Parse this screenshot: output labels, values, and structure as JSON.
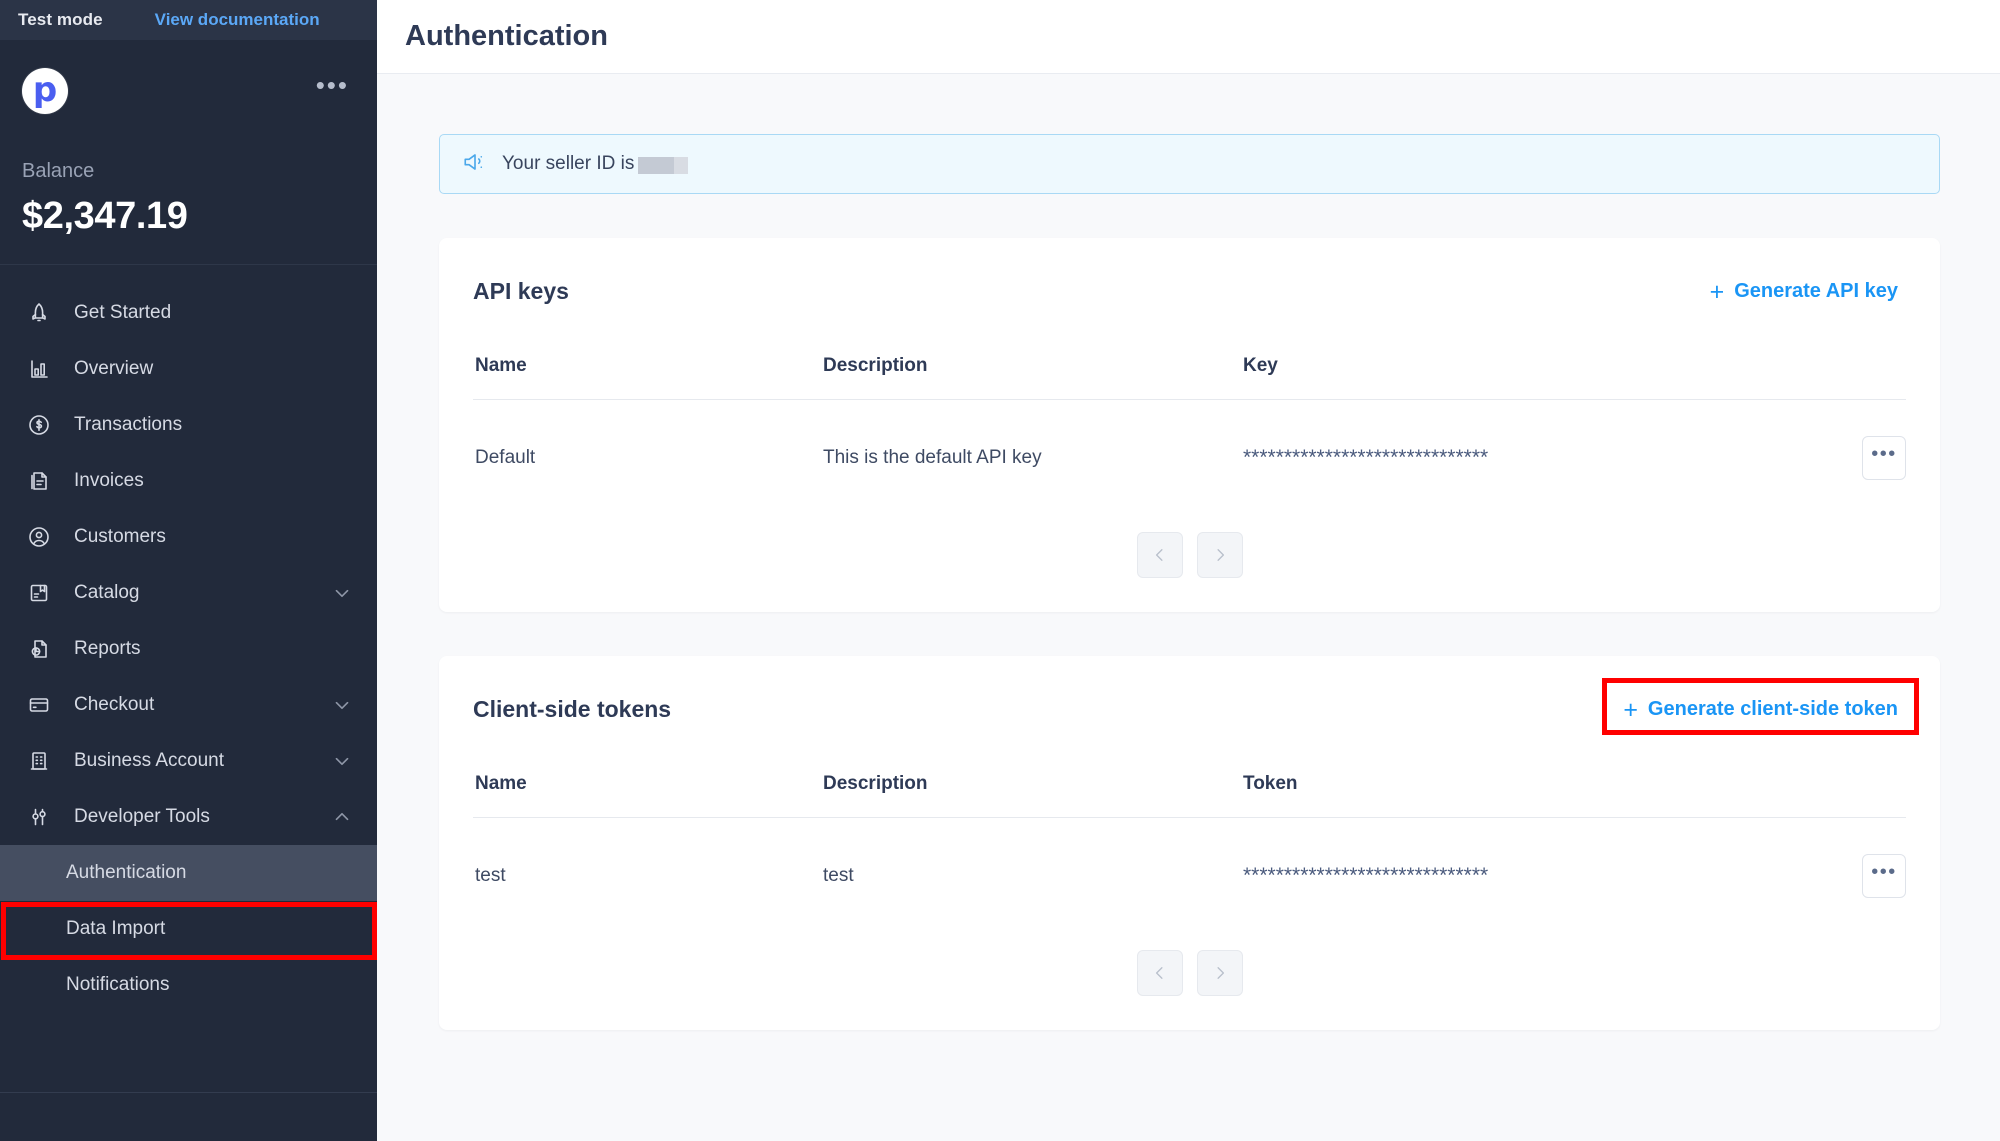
{
  "topbar": {
    "test_mode_label": "Test mode",
    "view_documentation_label": "View documentation"
  },
  "sidebar": {
    "brand_logo_letter": "p",
    "kebab_label": "•••",
    "balance_label": "Balance",
    "balance_value": "$2,347.19",
    "items": [
      {
        "label": "Get Started",
        "icon": "rocket-icon",
        "expandable": false
      },
      {
        "label": "Overview",
        "icon": "bar-chart-icon",
        "expandable": false
      },
      {
        "label": "Transactions",
        "icon": "dollar-circle-icon",
        "expandable": false
      },
      {
        "label": "Invoices",
        "icon": "invoice-icon",
        "expandable": false
      },
      {
        "label": "Customers",
        "icon": "user-circle-icon",
        "expandable": false
      },
      {
        "label": "Catalog",
        "icon": "box-icon",
        "expandable": true,
        "expanded": false
      },
      {
        "label": "Reports",
        "icon": "report-icon",
        "expandable": false
      },
      {
        "label": "Checkout",
        "icon": "card-icon",
        "expandable": true,
        "expanded": false
      },
      {
        "label": "Business Account",
        "icon": "building-icon",
        "expandable": true,
        "expanded": false
      },
      {
        "label": "Developer Tools",
        "icon": "sliders-icon",
        "expandable": true,
        "expanded": true
      }
    ],
    "sub_items": [
      {
        "label": "Authentication",
        "active": true
      },
      {
        "label": "Data Import",
        "active": false
      },
      {
        "label": "Notifications",
        "active": false
      }
    ]
  },
  "page": {
    "title": "Authentication"
  },
  "banner": {
    "icon": "megaphone-icon",
    "text": "Your seller ID is",
    "redacted_value": ""
  },
  "api_keys_card": {
    "title": "API keys",
    "generate_button": {
      "label": "Generate API key",
      "plus": "+"
    },
    "columns": [
      "Name",
      "Description",
      "Key"
    ],
    "rows": [
      {
        "name": "Default",
        "description": "This is the default API key",
        "key": "******************************",
        "actions_label": "•••"
      }
    ],
    "pagination": {
      "prev": "‹",
      "next": "›"
    }
  },
  "client_tokens_card": {
    "title": "Client-side tokens",
    "generate_button": {
      "label": "Generate client-side token",
      "plus": "+"
    },
    "columns": [
      "Name",
      "Description",
      "Token"
    ],
    "rows": [
      {
        "name": "test",
        "description": "test",
        "key": "******************************",
        "actions_label": "•••"
      }
    ],
    "pagination": {
      "prev": "‹",
      "next": "›"
    }
  },
  "highlights": {
    "color": "#ff0000",
    "targets": [
      "sidebar-item-authentication",
      "generate-client-side-token-button"
    ]
  },
  "colors": {
    "sidebar_bg": "#222a3b",
    "topbar_bg": "#2b3447",
    "active_item_bg": "#454e61",
    "link_blue": "#1a95f5",
    "brand_blue": "#4a5ef0",
    "page_bg": "#f8f9fb",
    "title_color": "#2e3a56"
  }
}
